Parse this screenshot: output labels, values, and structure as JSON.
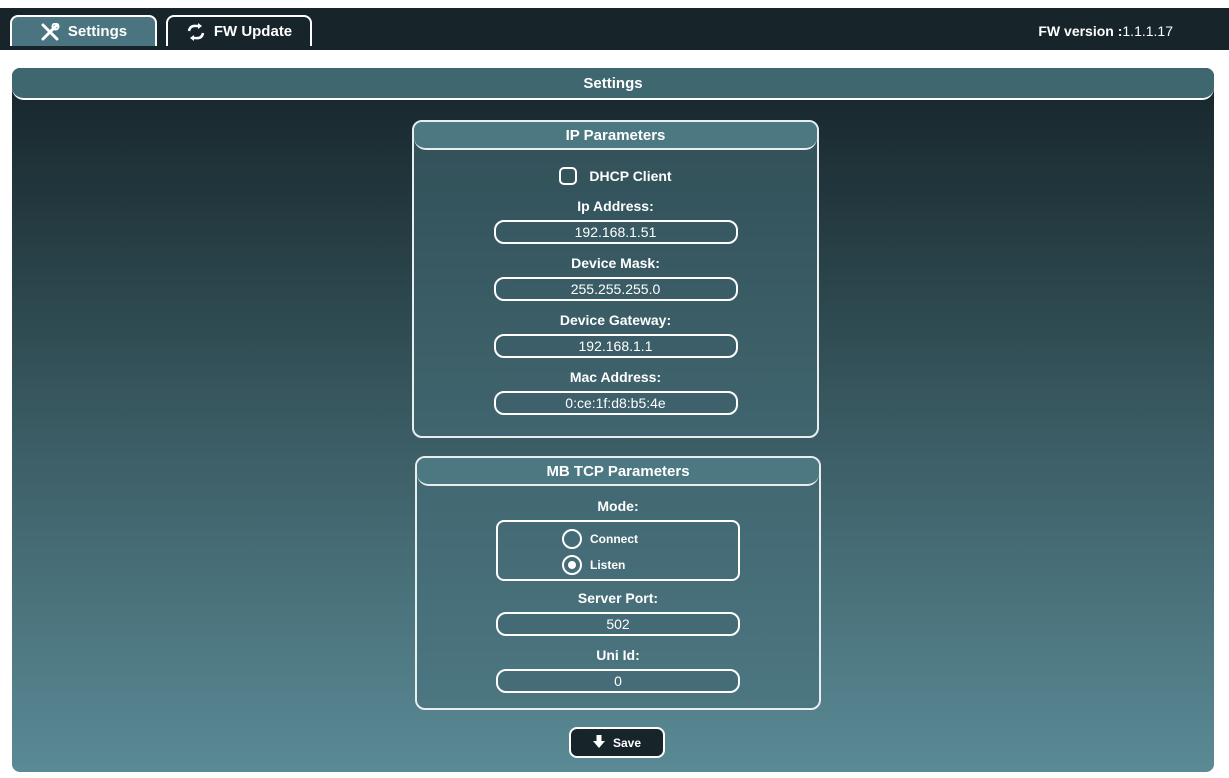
{
  "tabs": {
    "settings": "Settings",
    "fw_update": "FW Update"
  },
  "fw_version": {
    "label": "FW version :",
    "value": "1.1.1.17"
  },
  "main": {
    "title": "Settings"
  },
  "ip_panel": {
    "title": "IP Parameters",
    "dhcp_label": "DHCP Client",
    "dhcp_checked": false,
    "ip_label": "Ip Address:",
    "ip_value": "192.168.1.51",
    "mask_label": "Device Mask:",
    "mask_value": "255.255.255.0",
    "gateway_label": "Device Gateway:",
    "gateway_value": "192.168.1.1",
    "mac_label": "Mac Address:",
    "mac_value": "0:ce:1f:d8:b5:4e"
  },
  "mb_panel": {
    "title": "MB TCP Parameters",
    "mode_label": "Mode:",
    "mode_options": [
      "Connect",
      "Listen"
    ],
    "mode_selected": "Listen",
    "port_label": "Server Port:",
    "port_value": "502",
    "uni_label": "Uni Id:",
    "uni_value": "0"
  },
  "save_label": "Save",
  "icons": {
    "settings_tab": "tools-icon",
    "fw_tab": "sync-icon",
    "save": "arrow-down-icon"
  },
  "colors": {
    "accent": "#4a7480",
    "dark": "#17252a",
    "border": "#ffffff"
  }
}
